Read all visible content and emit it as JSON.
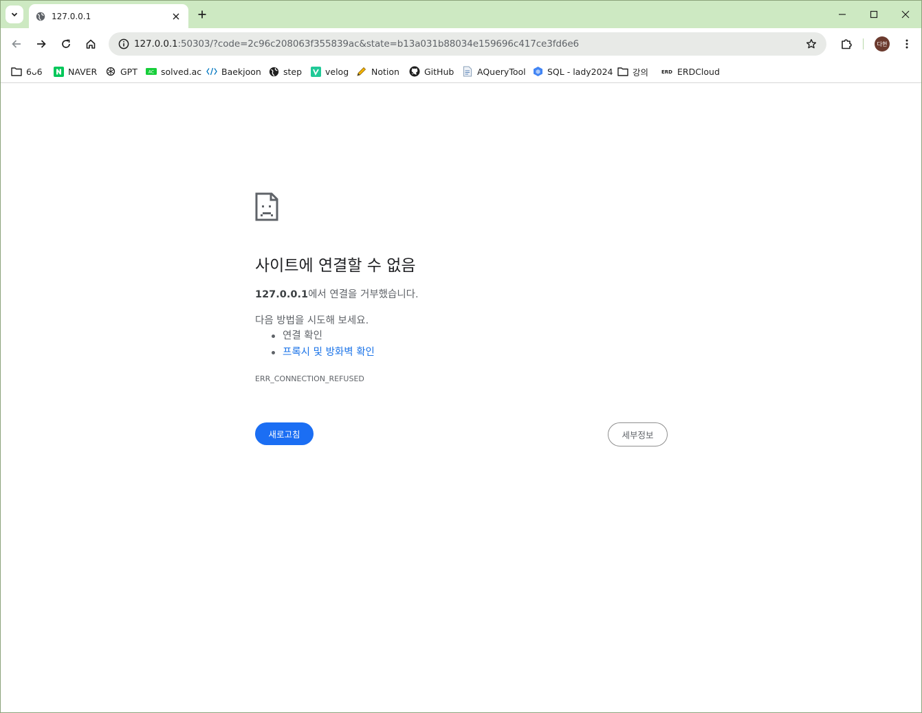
{
  "tab": {
    "title": "127.0.0.1"
  },
  "omnibox": {
    "host": "127.0.0.1",
    "rest": ":50303/?code=2c96c208063f355839ac&state=b13a031b88034e159696c417ce3fd6e6"
  },
  "profile": {
    "avatar_text": "다현"
  },
  "bookmarks": [
    {
      "label": "6ᴗ6",
      "icon": "folder-icon"
    },
    {
      "label": "NAVER",
      "icon": "naver-icon"
    },
    {
      "label": "GPT",
      "icon": "openai-icon"
    },
    {
      "label": "solved.ac",
      "icon": "solvedac-icon"
    },
    {
      "label": "Baekjoon",
      "icon": "code-icon"
    },
    {
      "label": "step",
      "icon": "globe-icon"
    },
    {
      "label": "velog",
      "icon": "velog-icon"
    },
    {
      "label": "Notion",
      "icon": "pencil-icon"
    },
    {
      "label": "GitHub",
      "icon": "github-icon"
    },
    {
      "label": "AQueryTool",
      "icon": "document-icon"
    },
    {
      "label": "SQL - lady2024",
      "icon": "cube-icon"
    },
    {
      "label": "강의",
      "icon": "folder-icon"
    },
    {
      "label": "ERDCloud",
      "icon": "erd-icon"
    }
  ],
  "error": {
    "title": "사이트에 연결할 수 없음",
    "host_bold": "127.0.0.1",
    "desc_rest": "에서 연결을 거부했습니다.",
    "try_label": "다음 방법을 시도해 보세요.",
    "suggestions": [
      "연결 확인",
      "프록시 및 방화벽 확인"
    ],
    "code": "ERR_CONNECTION_REFUSED",
    "reload_label": "새로고침",
    "details_label": "세부정보"
  },
  "colors": {
    "tabstrip": "#cde9c2",
    "primary_button": "#1b6ef3",
    "link": "#1a73e8"
  }
}
